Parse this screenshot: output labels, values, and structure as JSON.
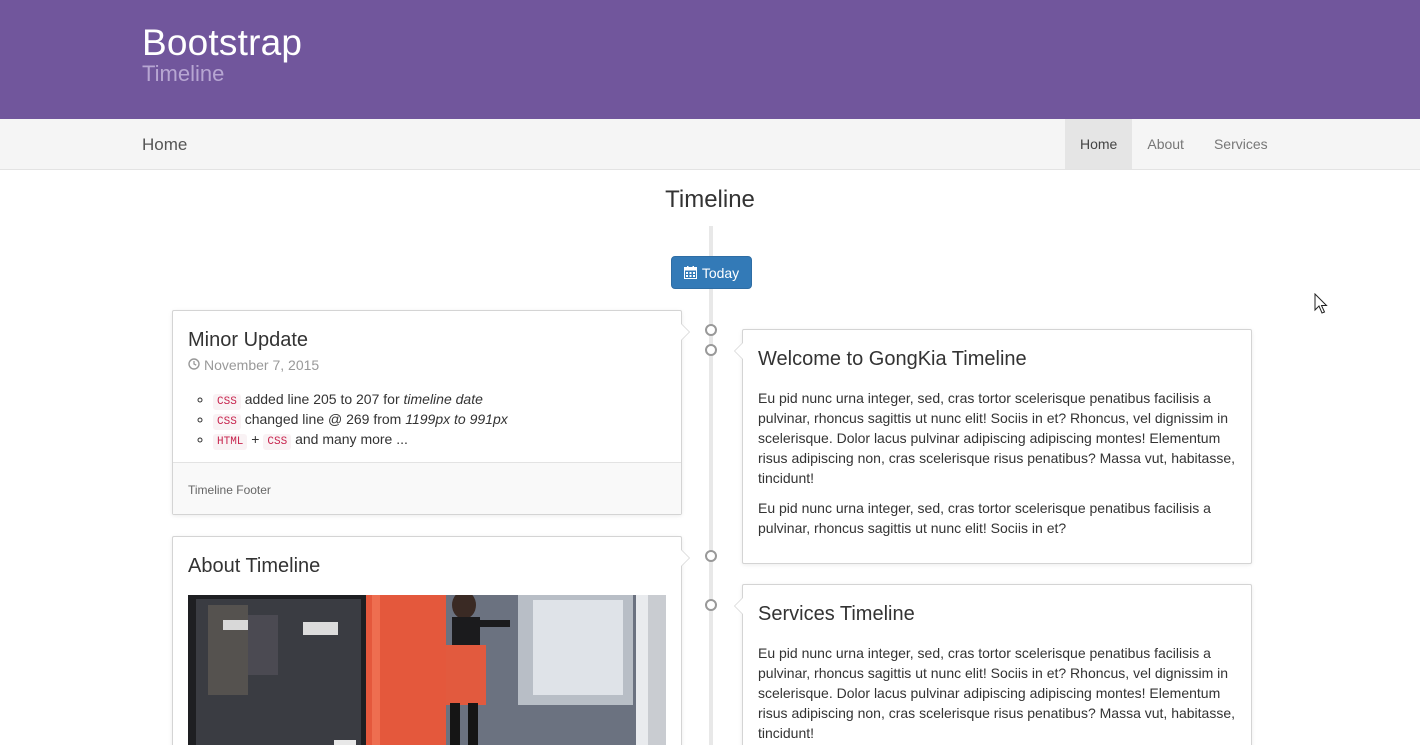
{
  "header": {
    "brand_title": "Bootstrap",
    "brand_subtitle": "Timeline",
    "bg_color": "#71569c"
  },
  "navbar": {
    "brand": "Home",
    "links": [
      {
        "label": "Home",
        "active": true
      },
      {
        "label": "About",
        "active": false
      },
      {
        "label": "Services",
        "active": false
      }
    ]
  },
  "page": {
    "title": "Timeline"
  },
  "timeline": {
    "today_button": {
      "label": "Today",
      "icon": "calendar-icon",
      "color": "#337ab7"
    },
    "panels": [
      {
        "title": "Minor Update",
        "date": "November 7, 2015",
        "date_icon": "clock-icon",
        "items": [
          {
            "code": "CSS",
            "text": "added line 205 to 207 for",
            "em": "timeline date"
          },
          {
            "code": "CSS",
            "text": "changed line @ 269 from",
            "em": "1199px to 991px"
          },
          {
            "code": "HTML",
            "plus": "+",
            "code2": "CSS",
            "text": "and many more ..."
          }
        ],
        "footer": "Timeline Footer"
      },
      {
        "title": "Welcome to GongKia Timeline",
        "paragraphs": [
          "Eu pid nunc urna integer, sed, cras tortor scelerisque penatibus facilisis a pulvinar, rhoncus sagittis ut nunc elit! Sociis in et? Rhoncus, vel dignissim in scelerisque. Dolor lacus pulvinar adipiscing adipiscing montes! Elementum risus adipiscing non, cras scelerisque risus penatibus? Massa vut, habitasse, tincidunt!",
          "Eu pid nunc urna integer, sed, cras tortor scelerisque penatibus facilisis a pulvinar, rhoncus sagittis ut nunc elit! Sociis in et?"
        ]
      },
      {
        "title": "About Timeline",
        "image": "street-photo"
      },
      {
        "title": "Services Timeline",
        "paragraphs": [
          "Eu pid nunc urna integer, sed, cras tortor scelerisque penatibus facilisis a pulvinar, rhoncus sagittis ut nunc elit! Sociis in et? Rhoncus, vel dignissim in scelerisque. Dolor lacus pulvinar adipiscing adipiscing montes! Elementum risus adipiscing non, cras scelerisque risus penatibus? Massa vut, habitasse, tincidunt!"
        ]
      }
    ]
  }
}
